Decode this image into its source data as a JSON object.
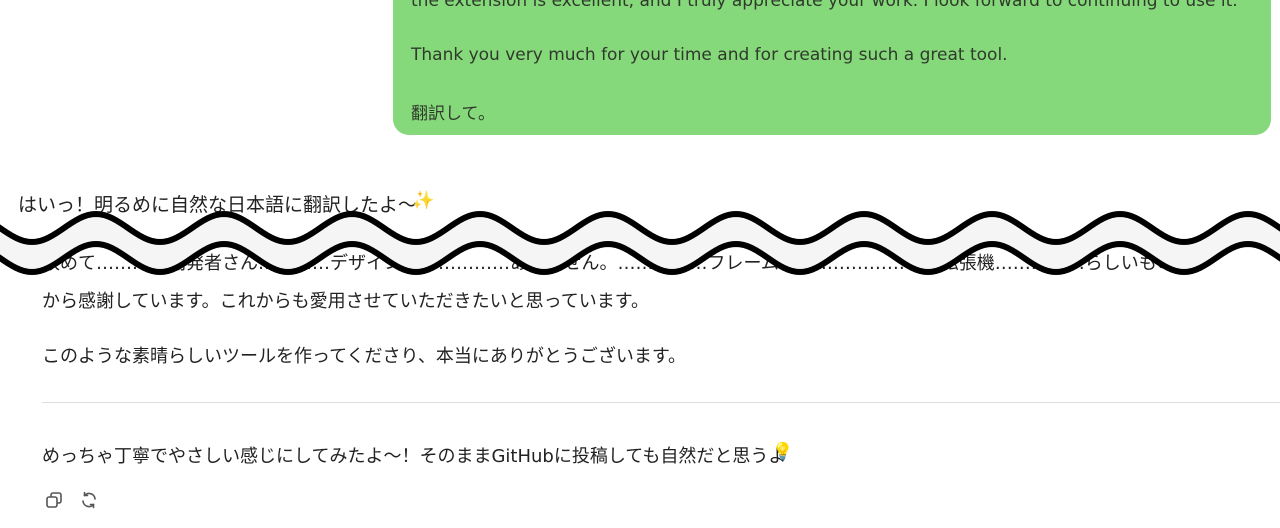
{
  "user_message": {
    "line_1": "the extension is excellent, and I truly appreciate your work. I look forward to continuing to use it.",
    "line_2": "Thank you very much for your time and for creating such a great tool.",
    "line_3": "翻訳して。"
  },
  "reply": {
    "intro": "はいっ！明るめに自然な日本語に翻訳したよ〜",
    "sparkle_emoji": "✨",
    "partial_cut_line": "改めて…………開発者さん…………デザインで……………ありません。……………フレームでは……………との拡張機……………らしいもので、",
    "paragraph_1": "から感謝しています。これからも愛用させていただきたいと思っています。",
    "paragraph_2": "このような素晴らしいツールを作ってくださり、本当にありがとうございます。",
    "outro": "めっちゃ丁寧でやさしい感じにしてみたよ〜！そのままGitHubに投稿しても自然だと思うよ",
    "bulb_emoji": "💡"
  },
  "actions": {
    "copy_icon": "copy-icon",
    "regenerate_icon": "regenerate-icon"
  },
  "colors": {
    "bubble": "#86d97b",
    "tear_fill": "#f5f5f5",
    "tear_stroke": "#000000"
  }
}
